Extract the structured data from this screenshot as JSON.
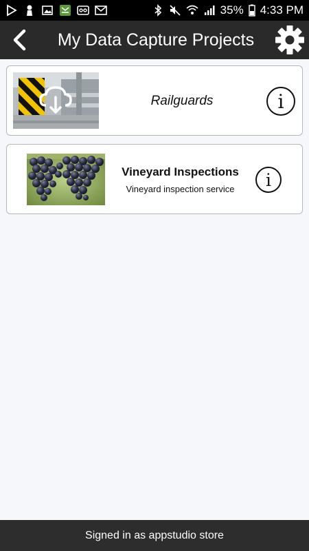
{
  "status_bar": {
    "battery": "35%",
    "time": "4:33 PM",
    "left_icons": [
      "play-store-icon",
      "person-icon",
      "image-icon",
      "app-notification-icon",
      "voicemail-icon",
      "gmail-icon"
    ],
    "right_icons": [
      "bluetooth-icon",
      "mute-icon",
      "wifi-icon",
      "signal-icon",
      "battery-icon"
    ]
  },
  "header": {
    "title": "My Data Capture Projects",
    "back_icon": "chevron-left-icon",
    "settings_icon": "gear-icon"
  },
  "projects": [
    {
      "title": "Railguards",
      "subtitle": "",
      "thumbnail": "railguard-photo-with-cloud-download-icon",
      "info_icon": "info-icon"
    },
    {
      "title": "Vineyard Inspections",
      "subtitle": "Vineyard inspection service",
      "thumbnail": "grapes-photo",
      "info_icon": "info-icon"
    }
  ],
  "footer": {
    "text": "Signed in as appstudio store"
  },
  "colors": {
    "header_bg": "#2a2a2a",
    "footer_bg": "#2d2d2d",
    "page_bg": "#f5f7fb",
    "card_border": "#b8b8b8"
  }
}
